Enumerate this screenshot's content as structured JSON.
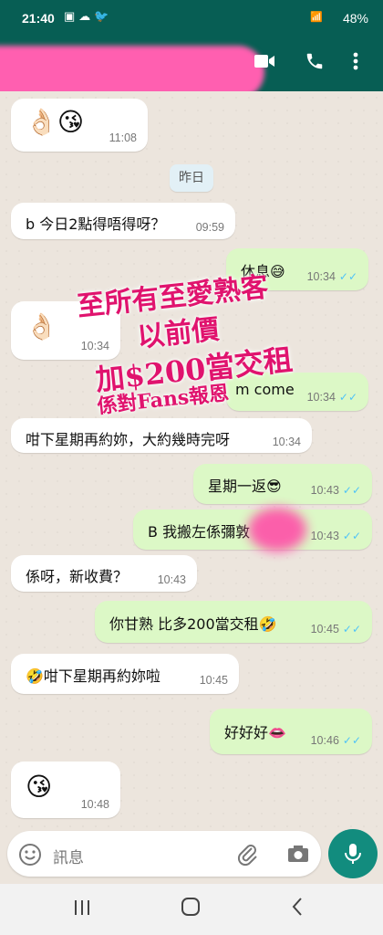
{
  "status_bar": {
    "time": "21:40",
    "icons": [
      "image-icon",
      "cloud-icon",
      "twitter-icon"
    ],
    "network": "VoLTE LTE1 · VoLTE LTE2",
    "battery": "48%"
  },
  "app_bar": {
    "contact_name_redacted": true,
    "icons": [
      "video-call-icon",
      "phone-icon",
      "more-icon"
    ]
  },
  "date_chip": "昨日",
  "messages": [
    {
      "dir": "in",
      "text": "👌🏻😘",
      "time": "11:08",
      "emoji_only": true
    },
    {
      "dir": "in",
      "text": "b 今日2點得唔得呀？",
      "time": "09:59"
    },
    {
      "dir": "out",
      "text": "休息😅",
      "time": "10:34",
      "read": true
    },
    {
      "dir": "in",
      "text": "👌🏻",
      "time": "10:34",
      "emoji_only": true
    },
    {
      "dir": "out",
      "text": "m come",
      "time": "10:34",
      "read": true
    },
    {
      "dir": "in",
      "text": "咁下星期再約妳，大約幾時完呀",
      "time": "10:34"
    },
    {
      "dir": "out",
      "text": "星期一返😎",
      "time": "10:43",
      "read": true
    },
    {
      "dir": "out",
      "text": "B  我搬左係彌敦",
      "time": "10:43",
      "read": true
    },
    {
      "dir": "in",
      "text": "係呀，新收費？",
      "time": "10:43"
    },
    {
      "dir": "out",
      "text": "你甘熟 比多200當交租🤣",
      "time": "10:45",
      "read": true
    },
    {
      "dir": "in",
      "text": "🤣咁下星期再約妳啦",
      "time": "10:45"
    },
    {
      "dir": "out",
      "text": "好好好👄",
      "time": "10:46",
      "read": true
    },
    {
      "dir": "in",
      "text": "😘",
      "time": "10:48",
      "emoji_only": true
    }
  ],
  "ticks": "✓✓",
  "overlay": {
    "line1": "至所有至愛熟客",
    "line2": "以前價",
    "line3": "加$200當交租",
    "line4": "係對Fans報恩",
    "color": "#e0136e"
  },
  "input": {
    "placeholder": "訊息",
    "icons": [
      "emoji-icon",
      "attach-icon",
      "camera-icon",
      "mic-icon"
    ]
  },
  "nav_bar": {
    "icons": [
      "recents-icon",
      "home-icon",
      "back-icon"
    ]
  },
  "colors": {
    "header": "#075e54",
    "incoming": "#ffffff",
    "outgoing": "#dcf8c6",
    "tick": "#4fc3f7",
    "mic": "#128c7e"
  }
}
